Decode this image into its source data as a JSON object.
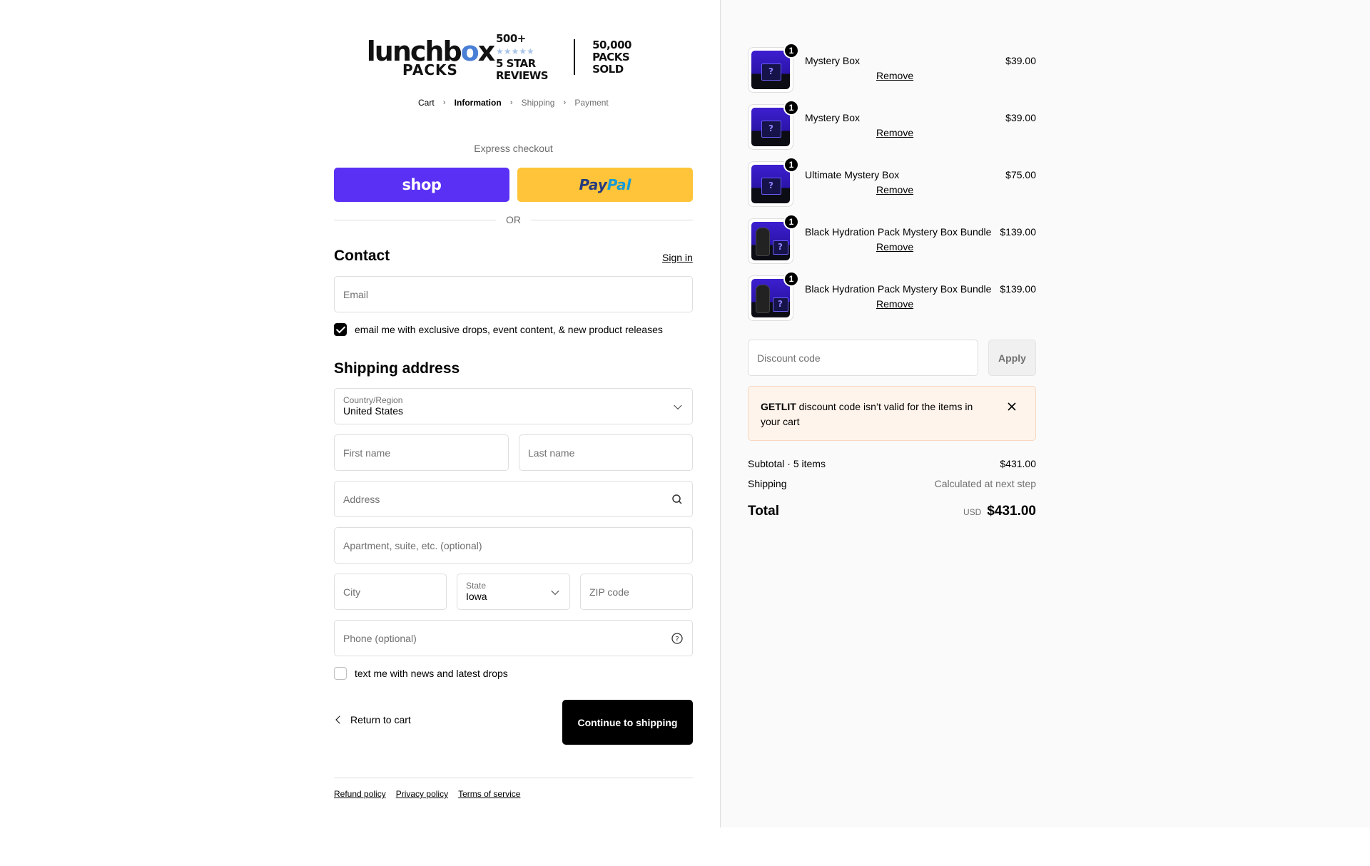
{
  "brand": {
    "logo_word_start": "lunchb",
    "logo_word_o": "o",
    "logo_word_end": "x",
    "logo_sub": "PACKS",
    "stat1_top": "500+",
    "stat1_stars": "★★★★★",
    "stat1_bottom": "5 STAR REVIEWS",
    "stat2_top": "50,000",
    "stat2_bottom": "PACKS SOLD"
  },
  "breadcrumb": [
    "Cart",
    "Information",
    "Shipping",
    "Payment"
  ],
  "express": {
    "label": "Express checkout",
    "shop_label": "shop",
    "paypal_pay": "Pay",
    "paypal_pal": "Pal",
    "or": "OR"
  },
  "contact": {
    "heading": "Contact",
    "sign_in": "Sign in",
    "email_placeholder": "Email",
    "marketing_label": "email me with exclusive drops, event content, & new product releases",
    "marketing_checked": true
  },
  "shipping": {
    "heading": "Shipping address",
    "country_label": "Country/Region",
    "country_value": "United States",
    "first_name": "First name",
    "last_name": "Last name",
    "address": "Address",
    "apartment": "Apartment, suite, etc. (optional)",
    "city": "City",
    "state_label": "State",
    "state_value": "Iowa",
    "zip": "ZIP code",
    "phone": "Phone (optional)",
    "sms_label": "text me with news and latest drops",
    "sms_checked": false
  },
  "actions": {
    "return": "Return to cart",
    "continue": "Continue to shipping"
  },
  "footer": [
    "Refund policy",
    "Privacy policy",
    "Terms of service"
  ],
  "cart": {
    "items": [
      {
        "name": "Mystery Box",
        "qty": "1",
        "price": "$39.00",
        "remove": "Remove",
        "thumb": "mystery-box"
      },
      {
        "name": "Mystery Box",
        "qty": "1",
        "price": "$39.00",
        "remove": "Remove",
        "thumb": "mystery-box"
      },
      {
        "name": "Ultimate Mystery Box",
        "qty": "1",
        "price": "$75.00",
        "remove": "Remove",
        "thumb": "mystery-box"
      },
      {
        "name": "Black Hydration Pack Mystery Box Bundle",
        "qty": "1",
        "price": "$139.00",
        "remove": "Remove",
        "thumb": "pack-bundle"
      },
      {
        "name": "Black Hydration Pack Mystery Box Bundle",
        "qty": "1",
        "price": "$139.00",
        "remove": "Remove",
        "thumb": "pack-bundle"
      }
    ],
    "discount_placeholder": "Discount code",
    "apply": "Apply",
    "alert_code": "GETLIT",
    "alert_text": " discount code isn’t valid for the items in your cart",
    "subtotal_label": "Subtotal · 5 items",
    "subtotal_value": "$431.00",
    "shipping_label": "Shipping",
    "shipping_value": "Calculated at next step",
    "total_label": "Total",
    "currency": "USD",
    "total_value": "$431.00"
  },
  "colors": {
    "shop": "#5a31f4",
    "paypal": "#ffc439",
    "alert_bg": "#fff4eb"
  }
}
